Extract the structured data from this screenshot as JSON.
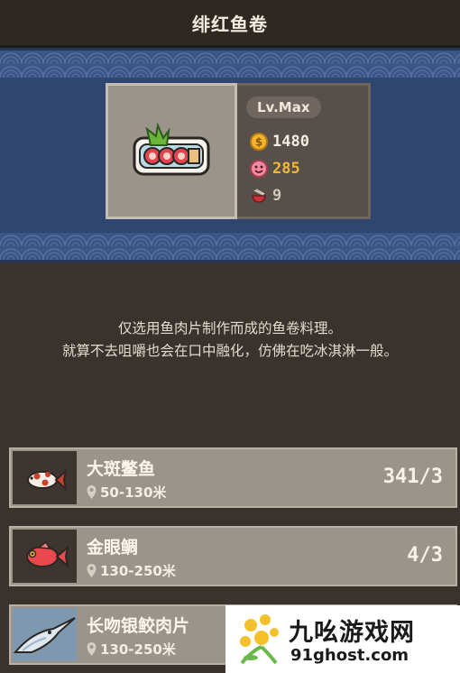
{
  "header": {
    "title": "绯红鱼卷"
  },
  "dish": {
    "level": "Lv.Max",
    "price": "1480",
    "taste": "285",
    "bowls": "9",
    "icon": "fish-roll-dish-icon",
    "accent_price": "#f2ede3",
    "accent_taste": "#f0b83a"
  },
  "description": {
    "line1": "仅选用鱼肉片制作而成的鱼卷料理。",
    "line2": "就算不去咀嚼也会在口中融化，仿佛在吃冰淇淋一般。"
  },
  "ingredients": [
    {
      "name": "大斑鳖鱼",
      "range": "50-130米",
      "count": "341/3",
      "icon": "spotted-fish-icon"
    },
    {
      "name": "金眼鲷",
      "range": "130-250米",
      "count": "4/3",
      "icon": "red-snapper-icon"
    },
    {
      "name": "长吻银鲛肉片",
      "range": "130-250米",
      "count": "",
      "icon": "swordfish-fillet-icon"
    }
  ],
  "watermark": {
    "cn": "九吆游戏网",
    "en": "91ghost.com"
  }
}
